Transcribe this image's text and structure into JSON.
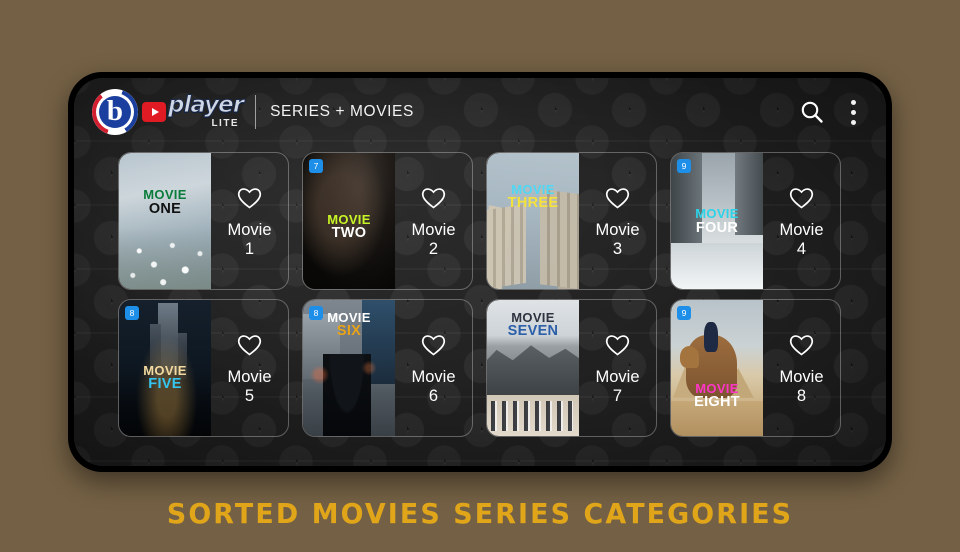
{
  "page": {
    "background_color": "#746145",
    "caption": "SORTED MOVIES SERIES CATEGORIES",
    "caption_color": "#e1a519"
  },
  "header": {
    "brand": {
      "b_glyph": "b",
      "play_icon": "play-icon",
      "word": "player",
      "sub_word": "LITE"
    },
    "title": "SERIES + MOVIES",
    "search_icon": "search-icon",
    "overflow_icon": "kebab-menu-icon"
  },
  "grid": {
    "cards": [
      {
        "poster_line1": "MOVIE",
        "poster_line2": "ONE",
        "line1_color": "#0a7c3a",
        "line2_color": "#101010",
        "title_top": "26%",
        "label": "Movie",
        "number": "1",
        "badge": "",
        "favorite_icon": "heart-outline-icon",
        "art": "white-flowers-misty-field"
      },
      {
        "poster_line1": "MOVIE",
        "poster_line2": "TWO",
        "line1_color": "#c8f526",
        "line2_color": "#ffffff",
        "title_top": "44%",
        "label": "Movie",
        "number": "2",
        "badge": "7",
        "favorite_icon": "heart-outline-icon",
        "art": "dark-portrait-low-key"
      },
      {
        "poster_line1": "MOVIE",
        "poster_line2": "THREE",
        "line1_color": "#4fd8f5",
        "line2_color": "#f5e13c",
        "title_top": "22%",
        "label": "Movie",
        "number": "3",
        "badge": "",
        "favorite_icon": "heart-outline-icon",
        "art": "cathedral-architecture-sky"
      },
      {
        "poster_line1": "MOVIE",
        "poster_line2": "FOUR",
        "line1_color": "#2bd4e8",
        "line2_color": "#ffffff",
        "title_top": "40%",
        "label": "Movie",
        "number": "4",
        "badge": "9",
        "favorite_icon": "heart-outline-icon",
        "art": "snowy-city-street"
      },
      {
        "poster_line1": "MOVIE",
        "poster_line2": "FIVE",
        "line1_color": "#f2d9a0",
        "line2_color": "#35c6f0",
        "title_top": "47%",
        "label": "Movie",
        "number": "5",
        "badge": "8",
        "favorite_icon": "heart-outline-icon",
        "art": "night-harbour-dark-blue"
      },
      {
        "poster_line1": "MOVIE",
        "poster_line2": "SIX",
        "line1_color": "#ffffff",
        "line2_color": "#e8a317",
        "title_top": "8%",
        "label": "Movie",
        "number": "6",
        "badge": "8",
        "favorite_icon": "heart-outline-icon",
        "art": "rainy-city-umbrella"
      },
      {
        "poster_line1": "MOVIE",
        "poster_line2": "SEVEN",
        "line1_color": "#2e3440",
        "line2_color": "#2b5fa8",
        "title_top": "8%",
        "label": "Movie",
        "number": "7",
        "badge": "",
        "favorite_icon": "heart-outline-icon",
        "art": "mountain-caravan-desert"
      },
      {
        "poster_line1": "MOVIE",
        "poster_line2": "EIGHT",
        "line1_color": "#ff35c8",
        "line2_color": "#ffffff",
        "title_top": "60%",
        "label": "Movie",
        "number": "8",
        "badge": "9",
        "favorite_icon": "heart-outline-icon",
        "art": "camel-rider-desert-dunes"
      }
    ]
  }
}
